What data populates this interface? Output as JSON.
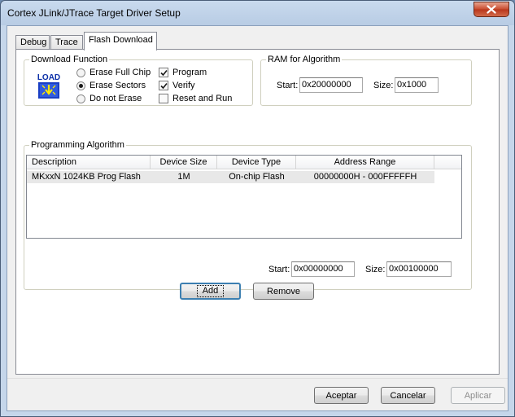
{
  "window": {
    "title": "Cortex JLink/JTrace Target Driver Setup"
  },
  "tabs": [
    {
      "label": "Debug",
      "active": false
    },
    {
      "label": "Trace",
      "active": false
    },
    {
      "label": "Flash Download",
      "active": true
    }
  ],
  "download_function": {
    "legend": "Download Function",
    "icon_text": "LOAD",
    "radios": [
      {
        "label": "Erase Full Chip",
        "selected": false
      },
      {
        "label": "Erase Sectors",
        "selected": true
      },
      {
        "label": "Do not Erase",
        "selected": false
      }
    ],
    "checks": [
      {
        "label": "Program",
        "checked": true
      },
      {
        "label": "Verify",
        "checked": true
      },
      {
        "label": "Reset and Run",
        "checked": false
      }
    ]
  },
  "ram": {
    "legend": "RAM for Algorithm",
    "start_label": "Start:",
    "start_value": "0x20000000",
    "size_label": "Size:",
    "size_value": "0x1000"
  },
  "programming": {
    "legend": "Programming Algorithm",
    "columns": [
      "Description",
      "Device Size",
      "Device Type",
      "Address Range"
    ],
    "rows": [
      {
        "description": "MKxxN 1024KB Prog Flash",
        "size": "1M",
        "type": "On-chip Flash",
        "range": "00000000H - 000FFFFFH"
      }
    ],
    "start_label": "Start:",
    "start_value": "0x00000000",
    "size_label": "Size:",
    "size_value": "0x00100000",
    "add_label": "Add",
    "remove_label": "Remove"
  },
  "footer": {
    "ok_label": "Aceptar",
    "cancel_label": "Cancelar",
    "apply_label": "Aplicar"
  }
}
